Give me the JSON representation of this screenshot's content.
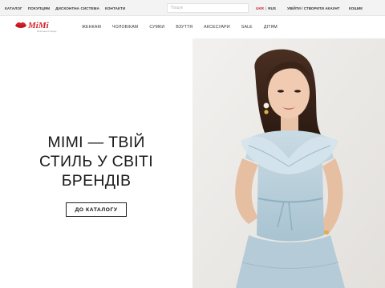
{
  "topbar": {
    "links": [
      "КАТАЛОГ",
      "ПОКУПЦЯМ",
      "ДИСКОНТНА СИСТЕМА",
      "КОНТАКТИ"
    ],
    "search_placeholder": "Пошук",
    "lang_active": "UKR",
    "lang_separator": "|",
    "lang_other": "RUS",
    "auth_label": "УВІЙТИ / СТВОРИТИ АКАУНТ",
    "cart_label": "КОШИК"
  },
  "header": {
    "logo_text": "MiMi",
    "logo_tagline": "Модні жіночі бренди",
    "nav": [
      "ЖЕНКАМ",
      "ЧОЛОВІКАМ",
      "СУМКИ",
      "ВЗУТТЯ",
      "АКСЕСУАРИ",
      "SALE",
      "ДІТЯМ"
    ]
  },
  "hero": {
    "title_lines": [
      "MIMI — ТВІЙ",
      "СТИЛЬ У СВІТІ",
      "БРЕНДІВ"
    ],
    "button_label": "ДО КАТАЛОГУ"
  },
  "colors": {
    "brand_red": "#d4202a",
    "topbar_bg": "#f3f3f3",
    "text": "#222222",
    "blouse_blue": "#b9d0dc"
  }
}
